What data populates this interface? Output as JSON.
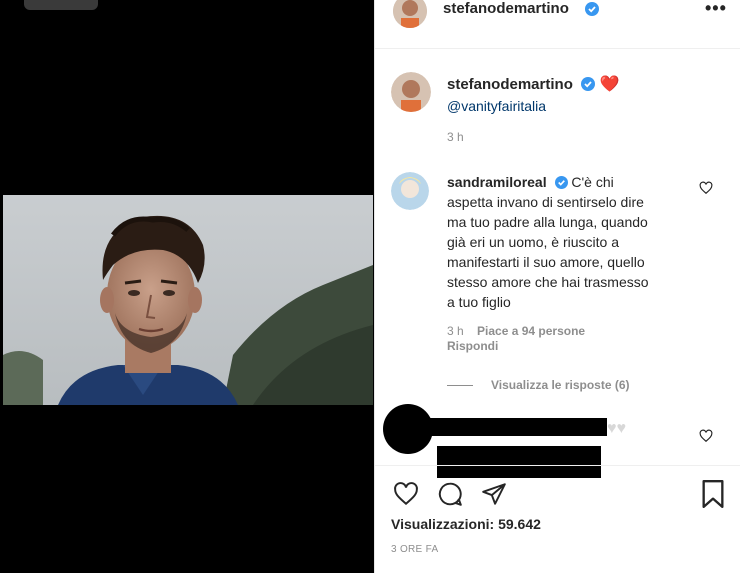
{
  "post": {
    "author": "stefanodemartino",
    "caption_emoji": "❤️",
    "caption_mention": "@vanityfairitalia",
    "caption_time": "3 h"
  },
  "comments": [
    {
      "user": "sandramiloreal",
      "lines": [
        "C'è chi",
        "aspetta invano di sentirselo dire",
        "ma tuo padre alla lunga, quando",
        "già eri un uomo, è riuscito a",
        "manifestarti il suo amore, quello",
        "stesso amore che hai trasmesso",
        "a tuo figlio"
      ],
      "time": "3 h",
      "likes": "Piace a 94 persone",
      "reply": "Rispondi",
      "view_replies": "Visualizza le risposte (6)"
    }
  ],
  "stats": {
    "views": "Visualizzazioni: 59.642",
    "date": "3 ORE FA"
  },
  "colors": {
    "verified": "#3897f0",
    "link": "#00376b",
    "muted": "#8e8e8e",
    "heart": "#ed4956"
  },
  "icons": [
    "more-icon",
    "heart-icon",
    "comment-icon",
    "share-icon",
    "bookmark-icon",
    "verified-icon"
  ]
}
